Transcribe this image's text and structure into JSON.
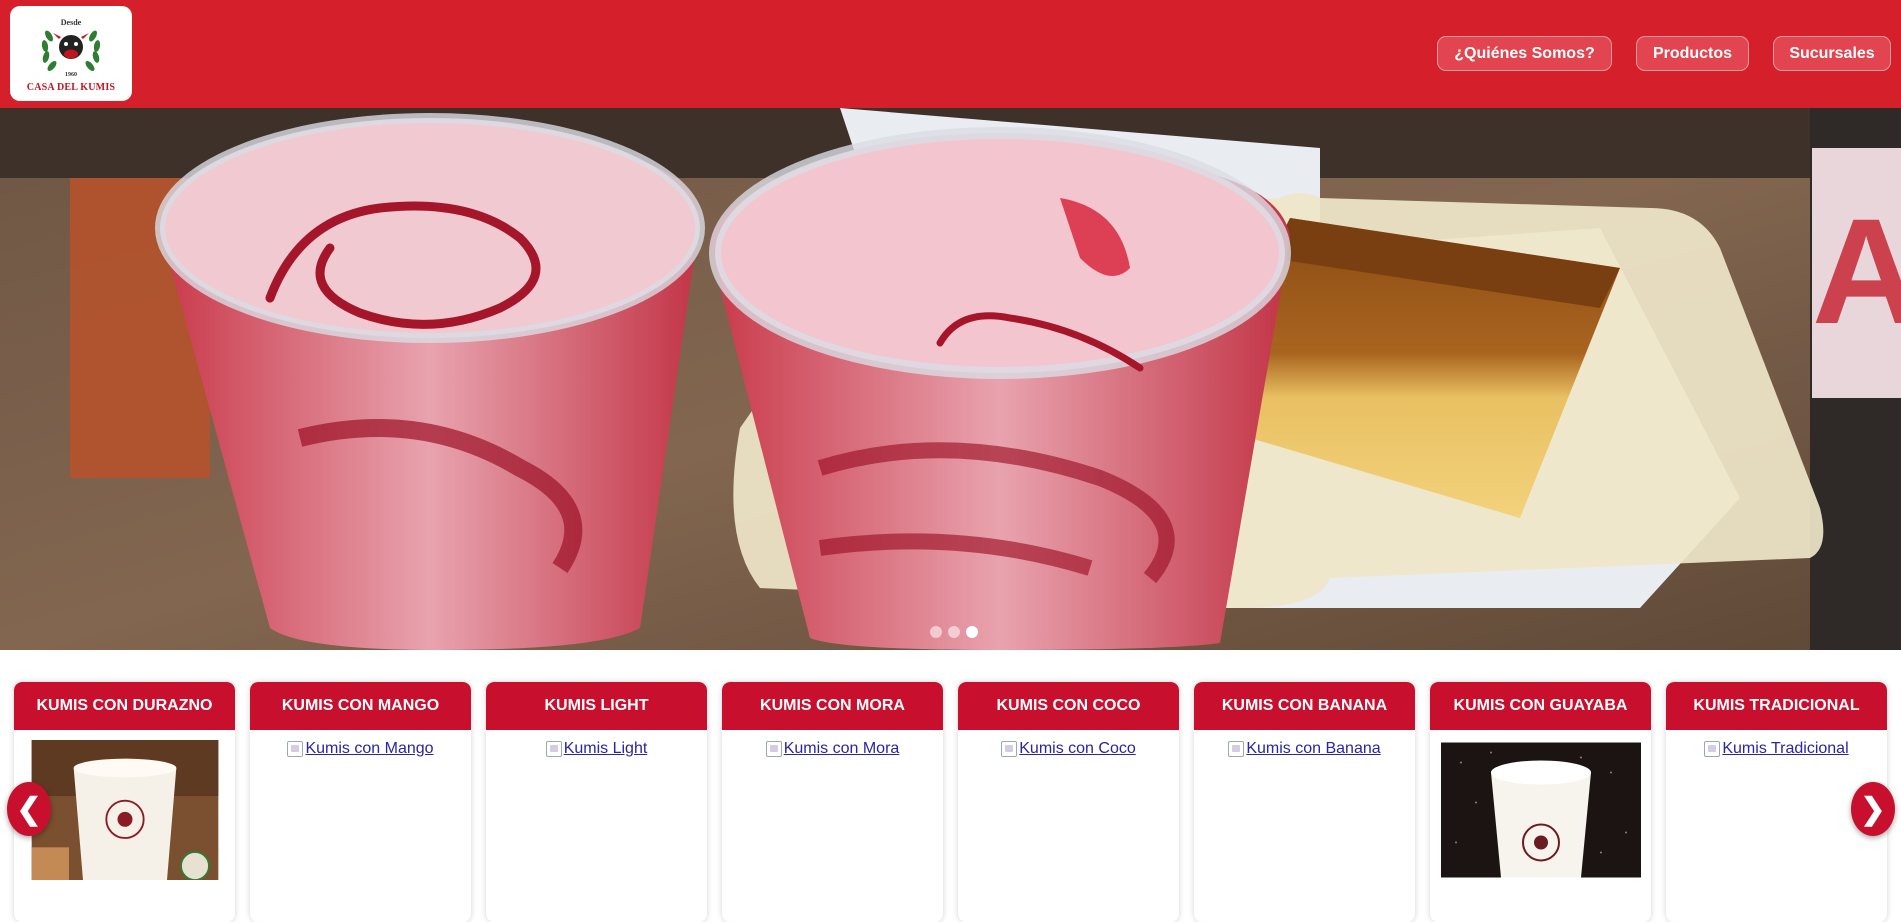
{
  "brand": {
    "logo_top": "Desde",
    "logo_year": "1960",
    "logo_name": "CASA DEL KUMIS",
    "color_primary": "#d51f2b"
  },
  "nav": {
    "items": [
      {
        "label": "¿Quiénes Somos?"
      },
      {
        "label": "Productos"
      },
      {
        "label": "Sucursales"
      }
    ]
  },
  "carousel": {
    "slides": 3,
    "active_index": 2
  },
  "products": {
    "prev_label": "❮",
    "next_label": "❯",
    "items": [
      {
        "title": "KUMIS CON DURAZNO",
        "image": "photo",
        "alt": ""
      },
      {
        "title": "KUMIS CON MANGO",
        "image": "broken",
        "alt": "Kumis con Mango"
      },
      {
        "title": "KUMIS LIGHT",
        "image": "broken",
        "alt": "Kumis Light"
      },
      {
        "title": "KUMIS CON MORA",
        "image": "broken",
        "alt": "Kumis con Mora"
      },
      {
        "title": "KUMIS CON COCO",
        "image": "broken",
        "alt": "Kumis con Coco"
      },
      {
        "title": "KUMIS CON BANANA",
        "image": "broken",
        "alt": "Kumis con Banana"
      },
      {
        "title": "KUMIS CON GUAYABA",
        "image": "photo",
        "alt": ""
      },
      {
        "title": "KUMIS TRADICIONAL",
        "image": "broken",
        "alt": "Kumis Tradicional"
      }
    ]
  }
}
